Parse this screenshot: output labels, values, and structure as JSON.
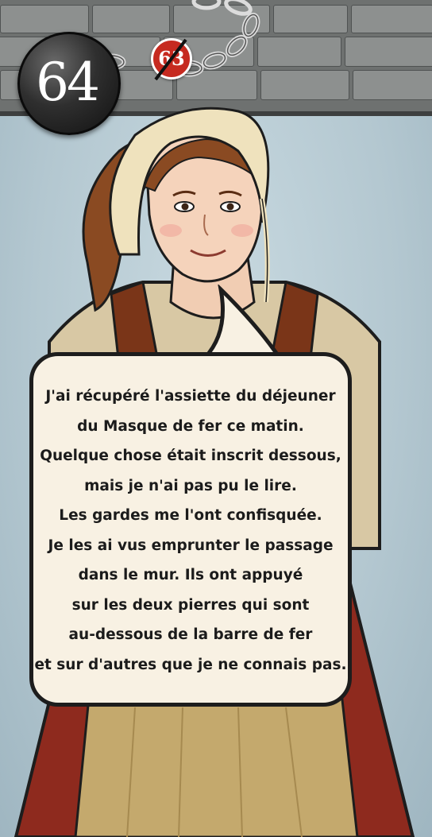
{
  "card": {
    "number": "64",
    "reference_number": "63",
    "reference_crossed_out": true
  },
  "dialogue": {
    "lines": [
      "J'ai récupéré l'assiette du déjeuner",
      "du Masque de fer ce matin.",
      "Quelque chose était inscrit dessous,",
      "mais je n'ai pas pu le lire.",
      "Les gardes me l'ont confisquée.",
      "Je les ai vus emprunter le passage",
      "dans le mur. Ils ont appuyé",
      "sur les deux pierres qui sont",
      "au-dessous de la barre de fer",
      "et sur d'autres que je ne connais pas."
    ]
  },
  "colors": {
    "background": "#b9cbd3",
    "stone_wall": "#6e7170",
    "reference_badge": "#c62a20",
    "bubble": "#f8f1e3",
    "skirt": "#8e2a1e"
  },
  "icons": {
    "number_badge": "cannonball-icon",
    "reference_badge": "crossed-reference-icon"
  }
}
